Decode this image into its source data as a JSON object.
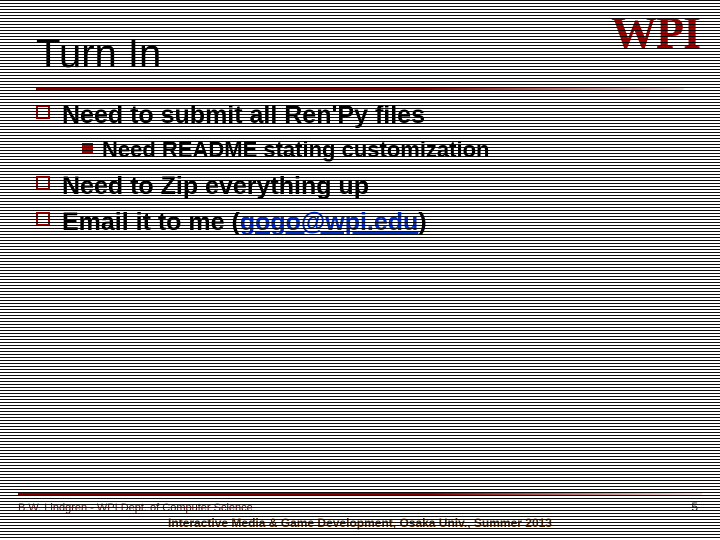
{
  "logo": "WPI",
  "title": "Turn In",
  "bullets": [
    {
      "text": "Need to submit all Ren'Py files"
    },
    {
      "text": "Need README stating customization",
      "level": 2
    },
    {
      "text": "Need to Zip everything up"
    },
    {
      "text_prefix": "Email it to me (",
      "email": "gogo@wpi.edu",
      "text_suffix": ")"
    }
  ],
  "footer": {
    "left": "B.W. Lindgren - WPI Dept. of Computer Science",
    "center": "Interactive Media & Game Development, Osaka Univ., Summer 2013",
    "page": "5"
  }
}
